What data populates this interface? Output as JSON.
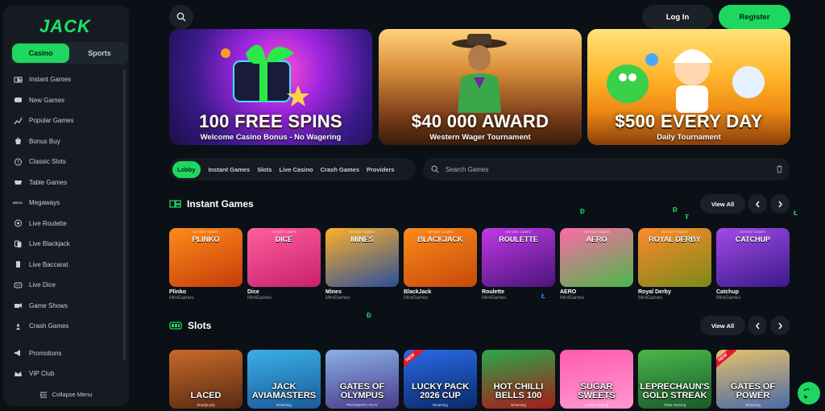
{
  "brand": {
    "logo": "JACK",
    "accent": "#1ed760"
  },
  "sidebar": {
    "tabs": [
      {
        "label": "Casino",
        "active": true
      },
      {
        "label": "Sports",
        "active": false
      }
    ],
    "items": [
      {
        "label": "Instant Games",
        "icon": "instant-games-icon"
      },
      {
        "label": "New Games",
        "icon": "new-games-icon"
      },
      {
        "label": "Popular Games",
        "icon": "popular-games-icon"
      },
      {
        "label": "Bonus Buy",
        "icon": "bonus-buy-icon"
      },
      {
        "label": "Classic Slots",
        "icon": "classic-slots-icon"
      },
      {
        "label": "Table Games",
        "icon": "table-games-icon"
      },
      {
        "label": "Megaways",
        "icon": "megaways-icon"
      },
      {
        "label": "Live Roulette",
        "icon": "live-roulette-icon"
      },
      {
        "label": "Live Blackjack",
        "icon": "live-blackjack-icon"
      },
      {
        "label": "Live Baccarat",
        "icon": "live-baccarat-icon"
      },
      {
        "label": "Live Dice",
        "icon": "live-dice-icon"
      },
      {
        "label": "Game Shows",
        "icon": "game-shows-icon"
      },
      {
        "label": "Crash Games",
        "icon": "crash-games-icon"
      }
    ],
    "extra": [
      {
        "label": "Promotions",
        "icon": "megaphone-icon"
      },
      {
        "label": "VIP Club",
        "icon": "crown-icon"
      }
    ],
    "megaways_icon_text": "MEGA",
    "collapse_label": "Collapse Menu"
  },
  "header": {
    "login_label": "Log In",
    "register_label": "Register"
  },
  "banners": [
    {
      "title": "100 FREE SPINS",
      "subtitle": "Welcome Casino Bonus - No Wagering"
    },
    {
      "title": "$40 000 AWARD",
      "subtitle": "Western Wager Tournament"
    },
    {
      "title": "$500 EVERY DAY",
      "subtitle": "Daily Tournament"
    }
  ],
  "filters": {
    "chips": [
      {
        "label": "Lobby",
        "active": true
      },
      {
        "label": "Instant Games",
        "active": false
      },
      {
        "label": "Slots",
        "active": false
      },
      {
        "label": "Live Casino",
        "active": false
      },
      {
        "label": "Crash Games",
        "active": false
      },
      {
        "label": "Providers",
        "active": false
      }
    ],
    "search_placeholder": "Search Games"
  },
  "instant": {
    "title": "Instant Games",
    "view_all": "View All",
    "tag": "INSTANT GAMES",
    "games": [
      {
        "thumb_title": "PLINKO",
        "name": "Plinko",
        "provider": "MiniGames",
        "colors": [
          "#ff8a1a",
          "#c43d0a"
        ]
      },
      {
        "thumb_title": "DICE",
        "name": "Dice",
        "provider": "MiniGames",
        "colors": [
          "#ff5fa0",
          "#c8206a"
        ]
      },
      {
        "thumb_title": "MINES",
        "name": "Mines",
        "provider": "MiniGames",
        "colors": [
          "#ffb02a",
          "#2a4f9a"
        ]
      },
      {
        "thumb_title": "BLACKJACK",
        "name": "BlackJack",
        "provider": "MiniGames",
        "colors": [
          "#ff8a1a",
          "#c44a0a"
        ]
      },
      {
        "thumb_title": "ROULETTE",
        "name": "Roulette",
        "provider": "MiniGames",
        "colors": [
          "#c03ae6",
          "#4a1478"
        ]
      },
      {
        "thumb_title": "AERO",
        "name": "AERO",
        "provider": "MiniGames",
        "colors": [
          "#ff6aa6",
          "#4ab84a"
        ]
      },
      {
        "thumb_title": "ROYAL DERBY",
        "name": "Royal Derby",
        "provider": "MiniGames",
        "colors": [
          "#ff8a2a",
          "#7a8a1a"
        ]
      },
      {
        "thumb_title": "CATCHUP",
        "name": "Catchup",
        "provider": "MiniGames",
        "colors": [
          "#a24ae6",
          "#3a1a8a"
        ]
      }
    ]
  },
  "slots": {
    "title": "Slots",
    "view_all": "View All",
    "games": [
      {
        "title": "LACED",
        "provider": "ShadyLady",
        "new": false,
        "colors": [
          "#c86a2a",
          "#5a2a12"
        ]
      },
      {
        "title": "JACK AVIAMASTERS",
        "provider": "BGaming",
        "new": false,
        "colors": [
          "#3ab0e6",
          "#1a5a9a"
        ]
      },
      {
        "title": "GATES OF OLYMPUS",
        "provider": "PRAGMATIC PLAY",
        "new": false,
        "colors": [
          "#8ab0e6",
          "#4a3a8a"
        ]
      },
      {
        "title": "LUCKY PACK 2026 CUP",
        "provider": "BGaming",
        "new": true,
        "colors": [
          "#2a6ae6",
          "#0a2a6a"
        ]
      },
      {
        "title": "HOT CHILLI BELLS 100",
        "provider": "BGaming",
        "new": false,
        "colors": [
          "#2aa84a",
          "#a81a1a"
        ]
      },
      {
        "title": "SUGAR SWEETS",
        "provider": "Axebit Gaming",
        "new": false,
        "colors": [
          "#ff5ab0",
          "#ff9ad0"
        ]
      },
      {
        "title": "LEPRECHAUN'S GOLD STREAK",
        "provider": "ToDa Gaming",
        "new": false,
        "colors": [
          "#4ab84a",
          "#1a5a2a"
        ]
      },
      {
        "title": "GATES OF POWER",
        "provider": "BGaming",
        "new": true,
        "colors": [
          "#e6c06a",
          "#4a6aa8"
        ]
      }
    ]
  },
  "floating_glyphs": [
    "Đ",
    "Ł",
    "Ŧ",
    "Đ",
    "Đ",
    "Ł"
  ]
}
